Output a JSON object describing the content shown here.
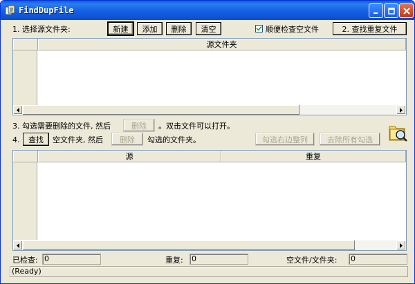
{
  "window": {
    "title": "FindDupFile"
  },
  "top_row": {
    "label": "1. 选择源文件夹:",
    "new_label": "新建",
    "add_label": "添加",
    "delete_label": "删除",
    "clear_label": "清空",
    "check_empty_label": "顺便检查空文件",
    "check_empty_checked": true,
    "find_dup_label": "2. 查找重复文件"
  },
  "source_list": {
    "column": "源文件夹"
  },
  "step3": {
    "prefix": "3. 勾选需要删除的文件, 然后",
    "delete_label": "删除",
    "suffix": "。双击文件可以打开。"
  },
  "step4": {
    "prefix": "4.",
    "find_label": "查找",
    "middle": "空文件夹, 然后",
    "delete_label": "删除",
    "suffix": "勾选的文件夹。",
    "check_right_label": "勾选右边整列",
    "uncheck_all_label": "去除所有勾选"
  },
  "results_list": {
    "columns": [
      "源",
      "重复"
    ]
  },
  "summary": {
    "checked_label": "已检查:",
    "checked_value": "0",
    "dup_label": "重复:",
    "dup_value": "0",
    "empty_label": "空文件/文件夹:",
    "empty_value": "0"
  },
  "status": {
    "text": "(Ready)"
  },
  "icons": [
    "app-icon",
    "minimize-icon",
    "maximize-icon",
    "close-icon",
    "folder-search-icon",
    "arrow-left-icon",
    "arrow-right-icon",
    "checkmark-icon"
  ]
}
